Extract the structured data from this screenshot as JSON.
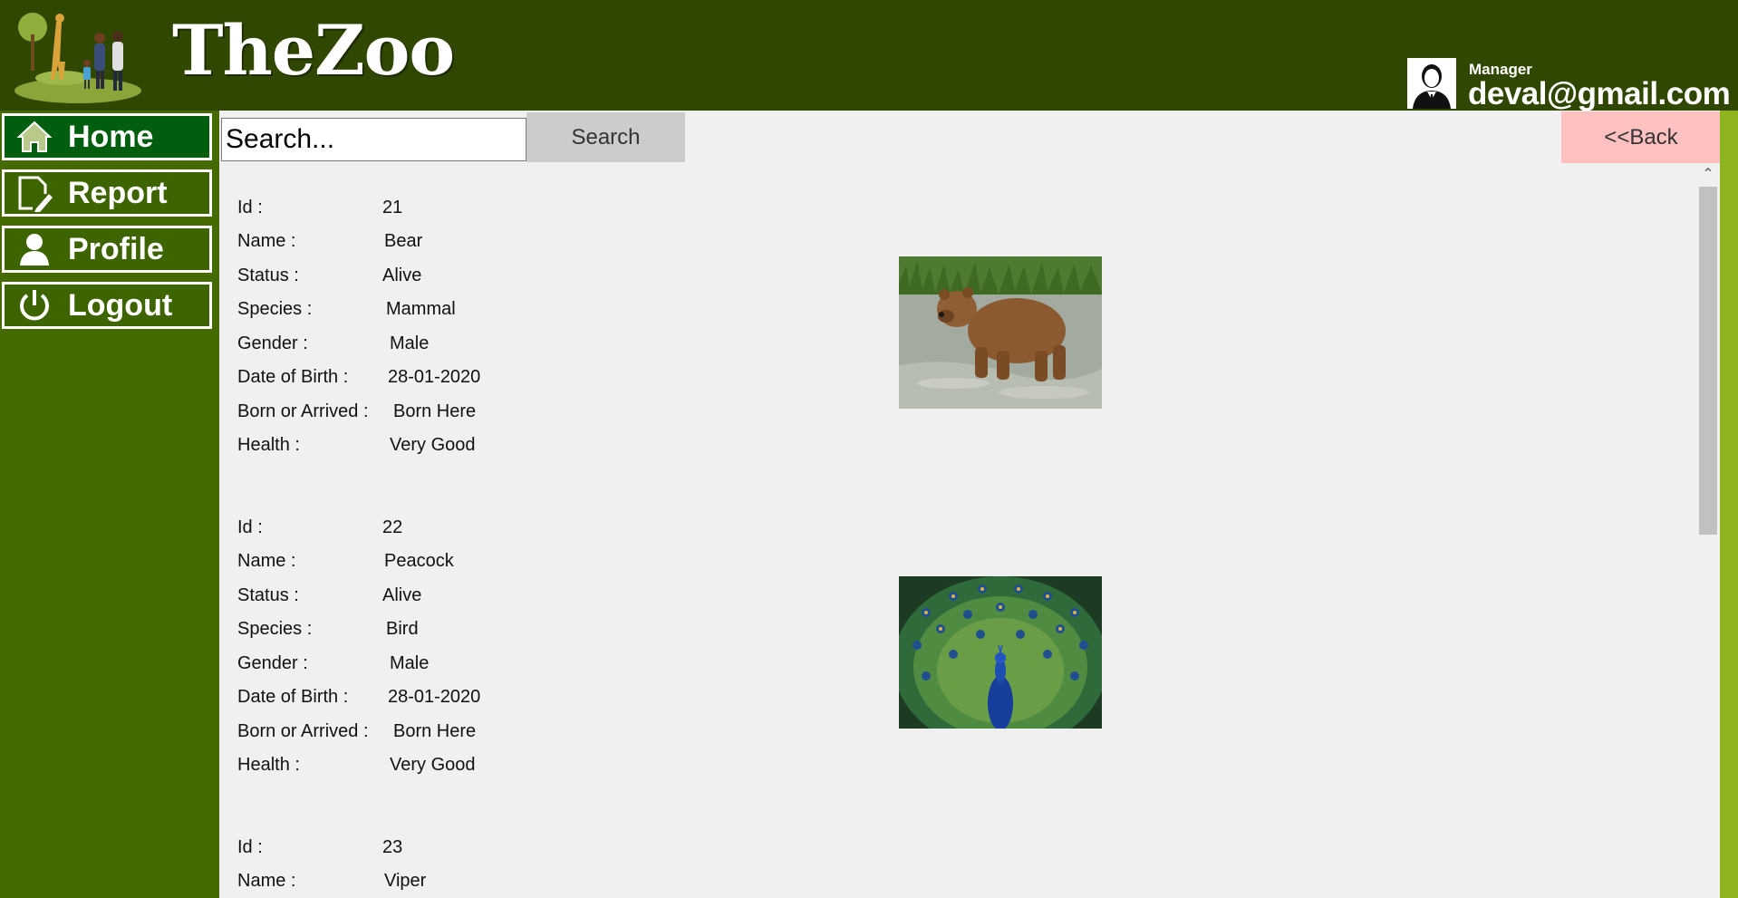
{
  "header": {
    "brand": "TheZoo",
    "user": {
      "role": "Manager",
      "email": "deval@gmail.com"
    }
  },
  "sidebar": {
    "items": [
      {
        "label": "Home",
        "icon": "home-icon",
        "active": true
      },
      {
        "label": "Report",
        "icon": "report-icon",
        "active": false
      },
      {
        "label": "Profile",
        "icon": "profile-icon",
        "active": false
      },
      {
        "label": "Logout",
        "icon": "logout-icon",
        "active": false
      }
    ]
  },
  "toolbar": {
    "search_placeholder": "Search...",
    "search_label": "Search",
    "back_label": "<<Back"
  },
  "field_labels": {
    "id": "Id :",
    "name": "Name :",
    "status": "Status :",
    "species": "Species :",
    "gender": "Gender :",
    "dob": "Date of Birth :",
    "origin": "Born or Arrived :",
    "health": "Health :"
  },
  "records": [
    {
      "id": "21",
      "name": "Bear",
      "status": "Alive",
      "species": "Mammal",
      "gender": "Male",
      "dob": "28-01-2020",
      "origin": "Born Here",
      "health": "Very Good",
      "photo": "bear-photo"
    },
    {
      "id": "22",
      "name": "Peacock",
      "status": "Alive",
      "species": "Bird",
      "gender": "Male",
      "dob": "28-01-2020",
      "origin": "Born Here",
      "health": "Very Good",
      "photo": "peacock-photo"
    },
    {
      "id": "23",
      "name": "Viper"
    }
  ],
  "colors": {
    "header_bg": "#2f4700",
    "sidebar_bg": "#456b00",
    "active_nav": "#005e0e",
    "content_bg": "#f0f0f0",
    "search_btn": "#cccccc",
    "back_btn": "#ffc0c0",
    "right_strip": "#8db41e"
  }
}
